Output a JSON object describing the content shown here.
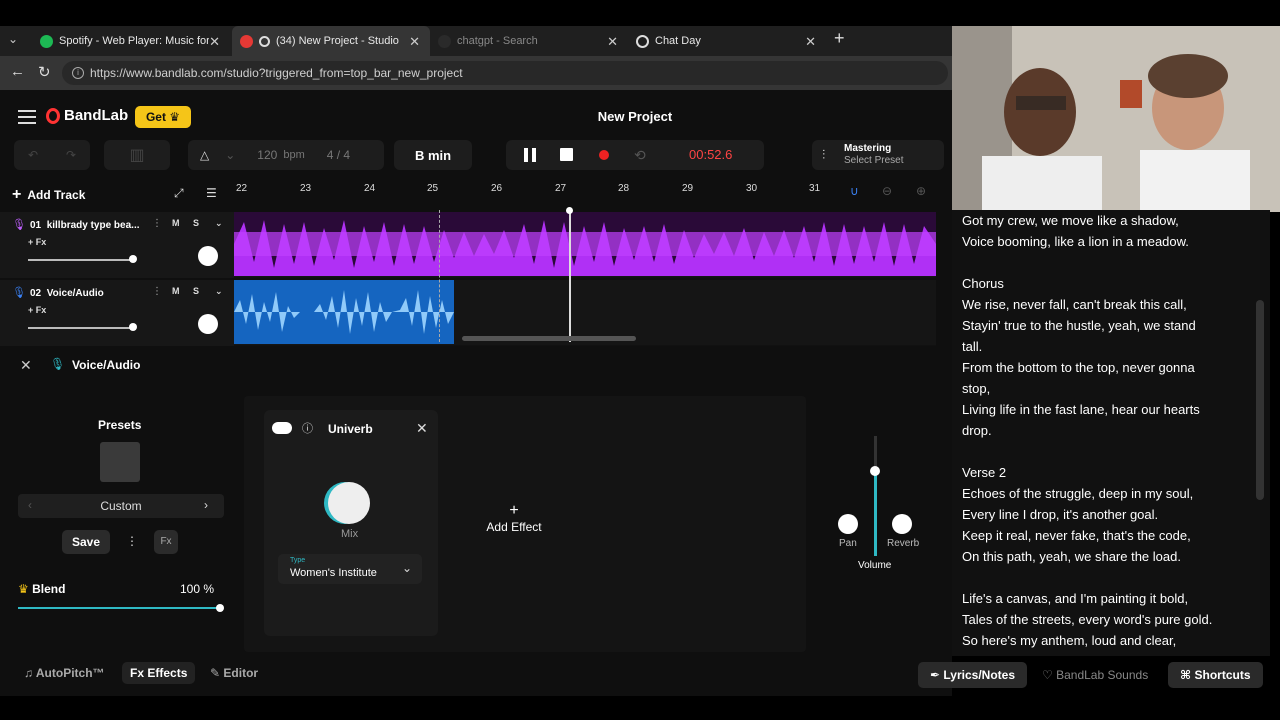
{
  "browser": {
    "tabs": [
      {
        "title": "Spotify - Web Player: Music for ev",
        "color": "#1db954",
        "active": false
      },
      {
        "title": "(34) New Project - Studio",
        "color": "#e8e8e8",
        "active": true
      },
      {
        "title": "chatgpt - Search",
        "color": "#444444",
        "active": false
      },
      {
        "title": "Chat Day",
        "color": "#dddddd",
        "active": false
      }
    ],
    "new_tab": "+",
    "url": "https://www.bandlab.com/studio?triggered_from=top_bar_new_project"
  },
  "app": {
    "brand": "BandLab",
    "get_label": "Get",
    "project_title": "New Project",
    "tempo_value": "120",
    "tempo_unit": "bpm",
    "time_signature": "4 / 4",
    "key": "B min",
    "time": "00:52.6",
    "mastering_label": "Mastering",
    "mastering_sub": "Select Preset",
    "add_track": "Add Track",
    "ruler": [
      "22",
      "23",
      "24",
      "25",
      "26",
      "27",
      "28",
      "29",
      "30",
      "31"
    ],
    "tracks": [
      {
        "number": "01",
        "name": "killbrady type bea...",
        "fx": "+ Fx",
        "mute": "M",
        "solo": "S",
        "color": "#a020f0"
      },
      {
        "number": "02",
        "name": "Voice/Audio",
        "fx": "+ Fx",
        "mute": "M",
        "solo": "S",
        "color": "#1e88e5"
      }
    ]
  },
  "panel": {
    "title": "Voice/Audio",
    "presets_title": "Presets",
    "preset_value": "Custom",
    "save_label": "Save",
    "blend_label": "Blend",
    "blend_value": "100 %",
    "effect_name": "Univerb",
    "mix_label": "Mix",
    "type_label": "Type",
    "type_value": "Women's Institute",
    "add_effect": "Add Effect",
    "volume_label": "Volume",
    "pan_label": "Pan",
    "reverb_label": "Reverb",
    "accent": "#2fb9c4"
  },
  "bottom_tabs": {
    "autopitch": "AutoPitch™",
    "effects": "Effects",
    "editor": "Editor",
    "lyrics": "Lyrics/Notes",
    "sounds": "BandLab Sounds",
    "shortcuts": "Shortcuts"
  },
  "lyrics": [
    "Got my crew, we move like a shadow,",
    "Voice booming, like a lion in a meadow.",
    "",
    "Chorus",
    "We rise, never fall, can't break this call,",
    "Stayin' true to the hustle, yeah, we stand",
    "tall.",
    "From the bottom to the top, never gonna",
    "stop,",
    "Living life in the fast lane, hear our hearts",
    "drop.",
    "",
    "Verse 2",
    "Echoes of the struggle, deep in my soul,",
    "Every line I drop, it's another goal.",
    "Keep it real, never fake, that's the code,",
    "On this path, yeah, we share the load.",
    "",
    "Life's a canvas, and I'm painting it bold,",
    "Tales of the streets, every word's pure gold.",
    "So here's my anthem, loud and clear,"
  ]
}
